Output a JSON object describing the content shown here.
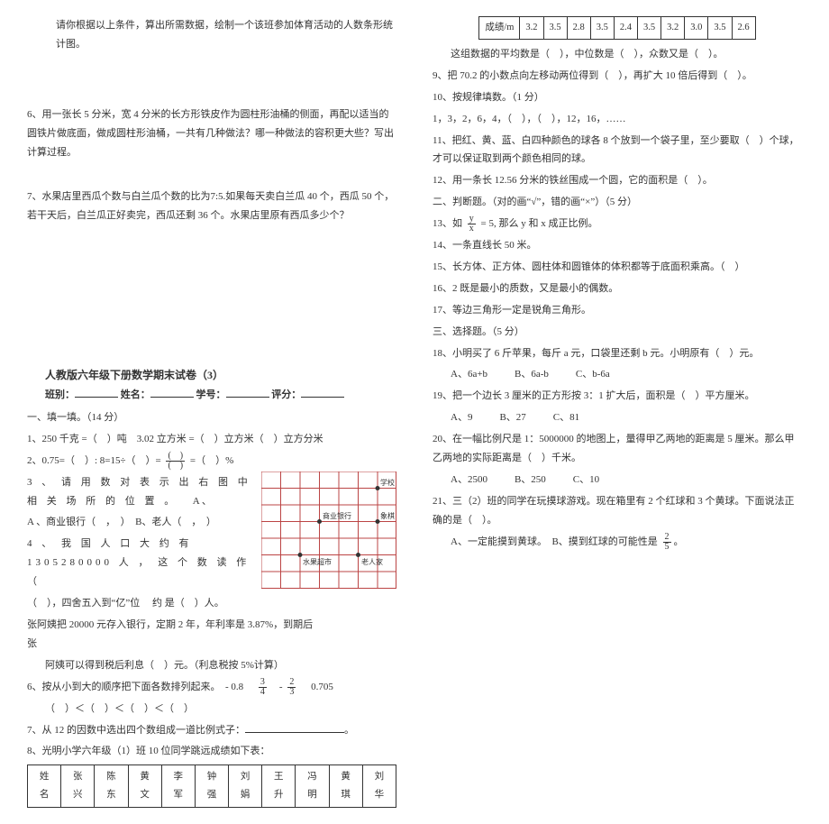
{
  "left": {
    "p_top": "请你根据以上条件，算出所需数据，绘制一个该班参加体育活动的人数条形统计图。",
    "q6": "6、用一张长 5 分米，宽 4 分米的长方形铁皮作为圆柱形油桶的侧面，再配以适当的圆铁片做底面，做成圆柱形油桶，一共有几种做法？哪一种做法的容积更大些？写出计算过程。",
    "q7": "7、水果店里西瓜个数与白兰瓜个数的比为7:5.如果每天卖白兰瓜 40 个，西瓜 50 个，若干天后，白兰瓜正好卖完，西瓜还剩 36 个。水果店里原有西瓜多少个？",
    "paper_title": "人教版六年级下册数学期末试卷（3）",
    "header": {
      "class": "班别：",
      "name": "姓名：",
      "id": "学号：",
      "score": "评分："
    },
    "sec1": "一、填一填。（14 分）",
    "q1_1": "1、250 千克 =（　）吨　3.02 立方米 =（　）立方米（　）立方分米",
    "q1_2a": "2、0.75=（　）: 8=15÷（　）= ",
    "q1_2b": " =（　）%",
    "q1_3a": "3 、 请 用 数 对 表 示 出 右 图 中 相 关 场 所 的 位 置 。",
    "q1_3_opts": "A 、商业银行（　，　）　B、老人（　，　）",
    "q1_4a": "4 、 我 国 人 口 大 约 有 1305280000 人 ， 这 个 数 读 作",
    "q1_4b": "（　），四舍五入到“亿”位 　约 是（　）人。",
    "q1_5": "张阿姨把 20000 元存入银行，定期 2 年，年利率是 3.87%，到期后　　　　　　　　　　　　张",
    "q1_5b": "阿姨可以得到税后利息（　）元。（利息税按 5%计算）",
    "q1_6": "6、按从小到大的顺序把下面各数排列起来。　- 0.8",
    "q1_6b": "0.705",
    "q1_6c": "（　）＜（　）＜（　）＜（　）",
    "q1_7": "7、从 12 的因数中选出四个数组成一道比例式子：",
    "q1_8": "8、光明小学六年级（1）班 10 位同学跳远成绩如下表：",
    "names": [
      "姓名",
      "张兴",
      "陈东",
      "黄文",
      "李军",
      "钟强",
      "刘娟",
      "王升",
      "冯明",
      "黄琪",
      "刘华"
    ],
    "grid_labels": {
      "school": "学校",
      "bank": "商业银行",
      "chess": "象棋",
      "fruit": "水果超市",
      "old": "老人家"
    }
  },
  "right": {
    "score_header": "成绩/m",
    "scores": [
      "3.2",
      "3.5",
      "2.8",
      "3.5",
      "2.4",
      "3.5",
      "3.2",
      "3.0",
      "3.5",
      "2.6"
    ],
    "p_avg": "这组数据的平均数是（　），中位数是（　），众数又是（　）。",
    "q9": "9、把 70.2 的小数点向左移动两位得到（　），再扩大 10 倍后得到（　）。",
    "q10": "10、按规律填数。（1 分）",
    "q10b": "1，3，2，6，4，（　），（　），12，16，……",
    "q11": "11、把红、黄、蓝、白四种颜色的球各 8 个放到一个袋子里，至少要取（　）个球，才可以保证取到两个颜色相同的球。",
    "q12": "12、用一条长 12.56 分米的铁丝围成一个圆，它的面积是（　）。",
    "sec2": "二、判断题。（对的画“√”，错的画“×”）（5 分）",
    "q13a": "13、如 ",
    "q13b": " = 5, 那么 y 和 x 成正比例。",
    "q14": "14、一条直线长 50 米。",
    "q15": "15、长方体、正方体、圆柱体和圆锥体的体积都等于底面积乘高。（　）",
    "q16": "16、2 既是最小的质数，又是最小的偶数。",
    "q17": "17、等边三角形一定是锐角三角形。",
    "sec3": "三、选择题。（5 分）",
    "q18": "18、小明买了 6 斤苹果，每斤 a 元，口袋里还剩 b 元。小明原有（　）元。",
    "q18_choices": {
      "a": "A、6a+b",
      "b": "B、6a-b",
      "c": "C、b-6a"
    },
    "q19": "19、把一个边长 3 厘米的正方形按 3：1 扩大后，面积是（　）平方厘米。",
    "q19_choices": {
      "a": "A、9",
      "b": "B、27",
      "c": "C、81"
    },
    "q20": "20、在一幅比例尺是 1：5000000 的地图上，量得甲乙两地的距离是 5 厘米。那么甲乙两地的实际距离是（　）千米。",
    "q20_choices": {
      "a": "A、2500",
      "b": "B、250",
      "c": "C、10"
    },
    "q21a": "21、三（2）班的同学在玩摸球游戏。现在箱里有 2 个红球和 3 个黄球。下面说法正确的是（　）。",
    "q21b": "A、一定能摸到黄球。　B、摸到红球的可能性是 "
  }
}
